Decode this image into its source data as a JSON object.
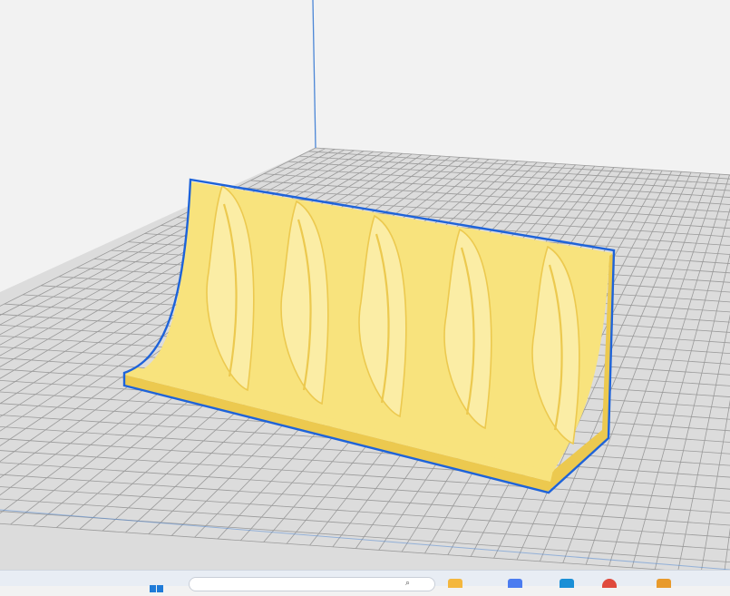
{
  "app": {
    "view": "3d-build-plate",
    "background_color": "#f2f2f2",
    "plate_color": "#dcdcdc",
    "grid_line_color": "#9a9a9a",
    "axis_color": "#4b86d6"
  },
  "model": {
    "name": "",
    "body_color": "#f8e37d",
    "shade_color": "#ecc94f",
    "highlight_color": "#fbeda5",
    "selection_outline_color": "#1e63d9",
    "selected": true,
    "rib_count": 5
  },
  "taskbar": {
    "start_icon": "windows-logo-icon",
    "search_placeholder": "",
    "search_icon": "search-icon",
    "pinned_apps": [
      {
        "icon": "folder-icon",
        "color": "#f4b73d"
      },
      {
        "icon": "store-icon",
        "color": "#4b7cf0"
      },
      {
        "icon": "edge-icon",
        "color": "#1a8fd6"
      },
      {
        "icon": "chrome-icon",
        "color": "#e04a3c"
      },
      {
        "icon": "slicer-app-icon",
        "color": "#e89a2b"
      }
    ]
  }
}
